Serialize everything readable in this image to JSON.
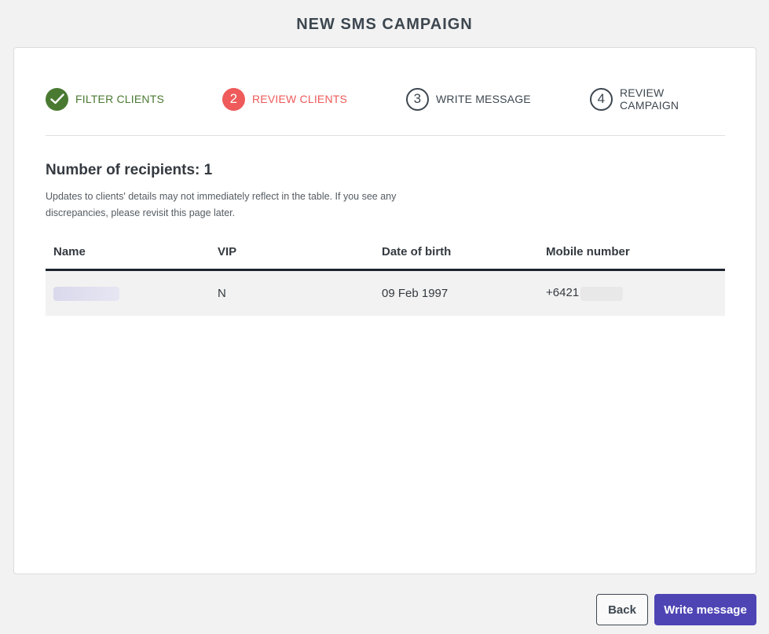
{
  "page": {
    "title": "NEW SMS CAMPAIGN"
  },
  "steps": [
    {
      "number": "",
      "label": "FILTER CLIENTS",
      "state": "done"
    },
    {
      "number": "2",
      "label": "REVIEW CLIENTS",
      "state": "active"
    },
    {
      "number": "3",
      "label": "WRITE MESSAGE",
      "state": "todo"
    },
    {
      "number": "4",
      "label": "REVIEW CAMPAIGN",
      "state": "todo"
    }
  ],
  "summary": {
    "recipients_label": "Number of recipients: 1",
    "note": "Updates to clients' details may not immediately reflect in the table. If you see any discrepancies, please revisit this page later."
  },
  "table": {
    "headers": [
      "Name",
      "VIP",
      "Date of birth",
      "Mobile number"
    ],
    "rows": [
      {
        "name": "",
        "vip": "N",
        "dob": "09 Feb 1997",
        "mobile_prefix": "+6421"
      }
    ]
  },
  "buttons": {
    "back": "Back",
    "next": "Write message"
  },
  "colors": {
    "done": "#4a7a32",
    "active": "#ef5a5a",
    "primary": "#4e44b4",
    "text": "#3d4750"
  }
}
